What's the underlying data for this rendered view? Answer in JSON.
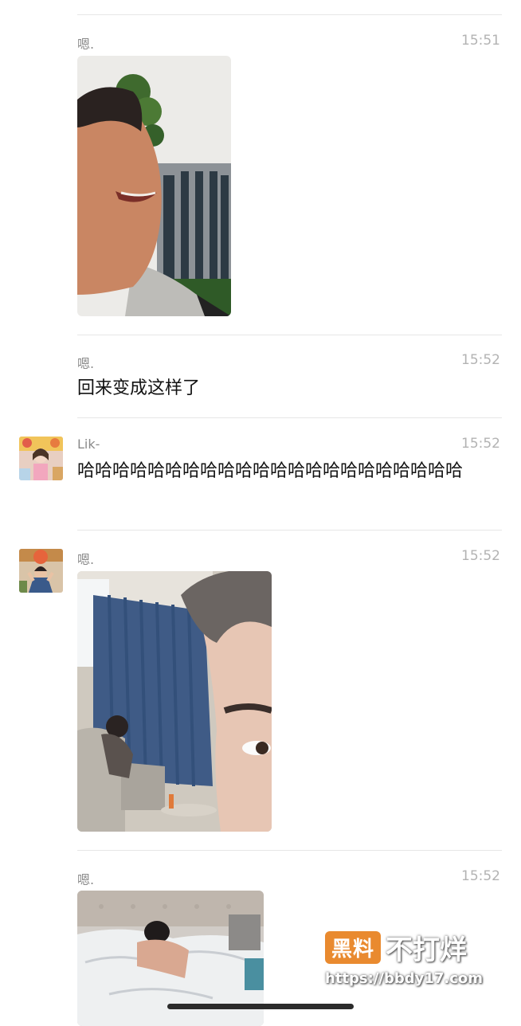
{
  "messages": [
    {
      "name": "嗯.",
      "time": "15:51"
    },
    {
      "name": "嗯.",
      "time": "15:52",
      "text": "回来变成这样了"
    },
    {
      "name": "Lik-",
      "time": "15:52",
      "text": "哈哈哈哈哈哈哈哈哈哈哈哈哈哈哈哈哈哈哈哈哈哈"
    },
    {
      "name": "嗯.",
      "time": "15:52"
    },
    {
      "name": "嗯.",
      "time": "15:52"
    }
  ],
  "watermark": {
    "badge": "黑料",
    "title": "不打烊",
    "url": "https://bbdy17.com"
  }
}
